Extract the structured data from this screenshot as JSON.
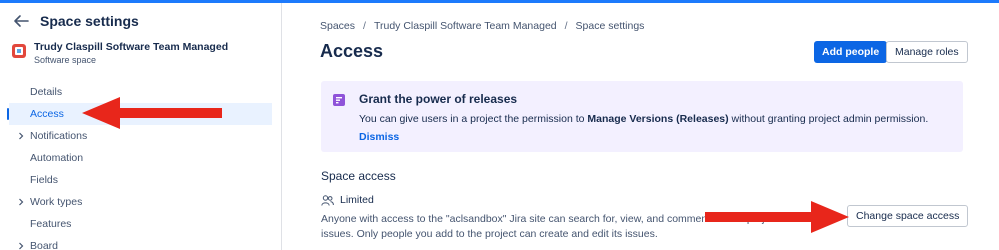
{
  "sidebar": {
    "title": "Space settings",
    "project": {
      "name": "Trudy Claspill Software Team Managed",
      "type": "Software space"
    },
    "items": [
      {
        "label": "Details",
        "expandable": false,
        "active": false
      },
      {
        "label": "Access",
        "expandable": false,
        "active": true
      },
      {
        "label": "Notifications",
        "expandable": true,
        "active": false
      },
      {
        "label": "Automation",
        "expandable": false,
        "active": false
      },
      {
        "label": "Fields",
        "expandable": false,
        "active": false
      },
      {
        "label": "Work types",
        "expandable": true,
        "active": false
      },
      {
        "label": "Features",
        "expandable": false,
        "active": false
      },
      {
        "label": "Board",
        "expandable": true,
        "active": false
      }
    ]
  },
  "breadcrumb": [
    "Spaces",
    "Trudy Claspill Software Team Managed",
    "Space settings"
  ],
  "page": {
    "title": "Access",
    "add_people_label": "Add people",
    "manage_roles_label": "Manage roles"
  },
  "banner": {
    "title": "Grant the power of releases",
    "text_before": "You can give users in a project the permission to ",
    "text_bold": "Manage Versions (Releases)",
    "text_after": " without granting project admin permission.",
    "dismiss_label": "Dismiss"
  },
  "space_access": {
    "title": "Space access",
    "level": "Limited",
    "description": "Anyone with access to the \"aclsandbox\" Jira site can search for, view, and comment on this project's issues. Only people you add to the project can create and edit its issues.",
    "change_label": "Change space access"
  },
  "colors": {
    "accent": "#0c66e4",
    "banner_bg": "#f3f0ff",
    "annotation_arrow": "#e8261b"
  }
}
